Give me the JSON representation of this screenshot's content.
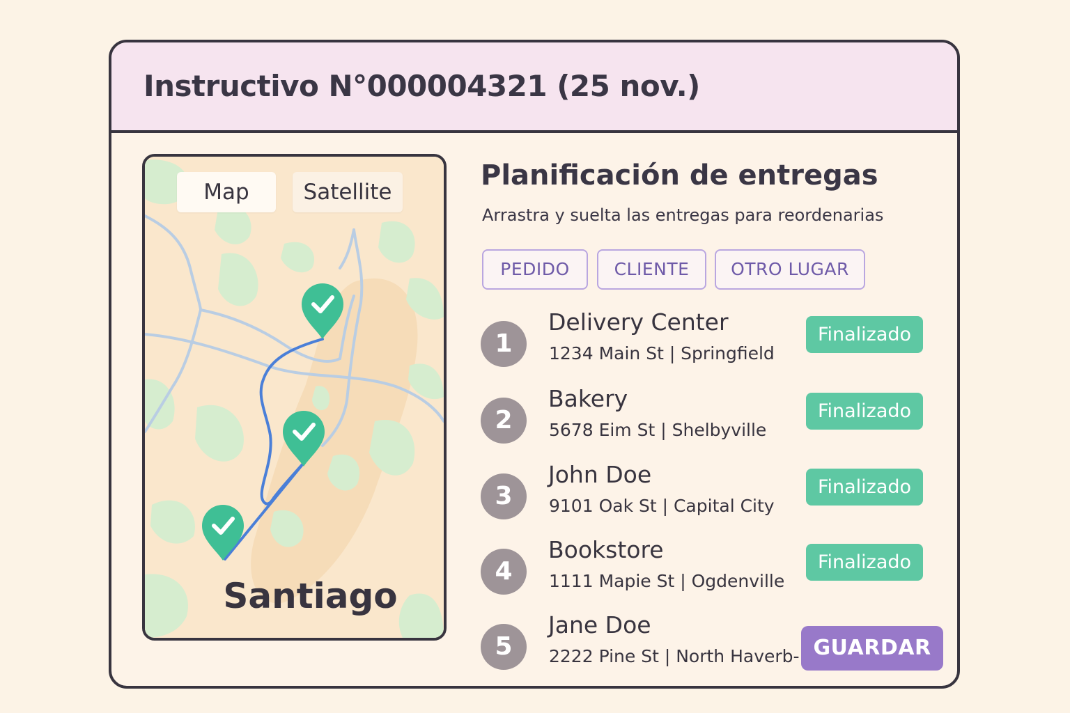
{
  "header": {
    "title": "Instructivo N°000004321 (25 nov.)"
  },
  "map": {
    "tabs": [
      "Map",
      "Satellite"
    ],
    "city": "Santiago",
    "pin_icon": "check-pin-icon",
    "route_color": "#4a7fd8",
    "pin_color": "#3fbf95"
  },
  "main": {
    "heading": "Planificación de entregas",
    "subheading": "Arrastra y suelta las entregas para reordenarias",
    "filters": [
      "PEDIDO",
      "CLIENTE",
      "OTRO LUGAR"
    ]
  },
  "deliveries": [
    {
      "number": "1",
      "name": "Delivery Center",
      "address": "1234 Main St | Springfield",
      "status": "Finalizado"
    },
    {
      "number": "2",
      "name": "Bakery",
      "address": "5678 Eim St | Shelbyville",
      "status": "Finalizado"
    },
    {
      "number": "3",
      "name": "John Doe",
      "address": "9101 Oak St | Capital City",
      "status": "Finalizado"
    },
    {
      "number": "4",
      "name": "Bookstore",
      "address": "1111 Mapie St | Ogdenville",
      "status": "Finalizado"
    },
    {
      "number": "5",
      "name": "Jane Doe",
      "address": "2222 Pine St | North Haverb-",
      "status": ""
    }
  ],
  "actions": {
    "save_label": "GUARDAR"
  },
  "colors": {
    "background": "#fcf3e6",
    "header": "#f6e4ef",
    "status_done": "#5ec8a3",
    "save_button": "#9879c9",
    "filter_border": "#b9a6e0"
  }
}
